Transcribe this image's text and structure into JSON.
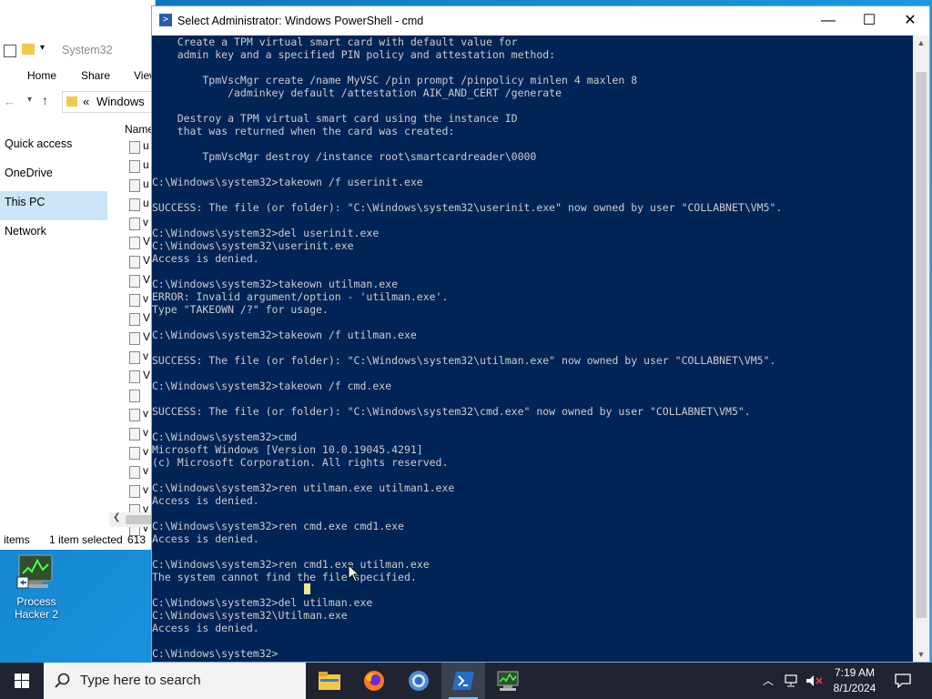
{
  "desktop": {
    "icons": [
      {
        "label": "Process Hacker 2"
      }
    ]
  },
  "explorer": {
    "title": "System32",
    "ribbon_tabs": [
      "Home",
      "Share",
      "View"
    ],
    "address": "Windows",
    "address_prefix": "«",
    "column_header": "Name",
    "nav": [
      "Quick access",
      "OneDrive",
      "This PC",
      "Network"
    ],
    "file_prefixes": [
      "u",
      "u",
      "u",
      "u",
      "v",
      "V",
      "V",
      "V",
      "v",
      "V",
      "V",
      "v",
      "V",
      "",
      "v",
      "v",
      "v",
      "v",
      "v",
      "v",
      "v"
    ],
    "status_items": "items",
    "status_selected": "1 item selected",
    "status_size": "613"
  },
  "powershell": {
    "title": "Select Administrator: Windows PowerShell - cmd",
    "console_lines": [
      "    Create a TPM virtual smart card with default value for",
      "    admin key and a specified PIN policy and attestation method:",
      "",
      "        TpmVscMgr create /name MyVSC /pin prompt /pinpolicy minlen 4 maxlen 8",
      "            /adminkey default /attestation AIK_AND_CERT /generate",
      "",
      "    Destroy a TPM virtual smart card using the instance ID",
      "    that was returned when the card was created:",
      "",
      "        TpmVscMgr destroy /instance root\\smartcardreader\\0000",
      "",
      "C:\\Windows\\system32>takeown /f userinit.exe",
      "",
      "SUCCESS: The file (or folder): \"C:\\Windows\\system32\\userinit.exe\" now owned by user \"COLLABNET\\VM5\".",
      "",
      "C:\\Windows\\system32>del userinit.exe",
      "C:\\Windows\\system32\\userinit.exe",
      "Access is denied.",
      "",
      "C:\\Windows\\system32>takeown utilman.exe",
      "ERROR: Invalid argument/option - 'utilman.exe'.",
      "Type \"TAKEOWN /?\" for usage.",
      "",
      "C:\\Windows\\system32>takeown /f utilman.exe",
      "",
      "SUCCESS: The file (or folder): \"C:\\Windows\\system32\\utilman.exe\" now owned by user \"COLLABNET\\VM5\".",
      "",
      "C:\\Windows\\system32>takeown /f cmd.exe",
      "",
      "SUCCESS: The file (or folder): \"C:\\Windows\\system32\\cmd.exe\" now owned by user \"COLLABNET\\VM5\".",
      "",
      "C:\\Windows\\system32>cmd",
      "Microsoft Windows [Version 10.0.19045.4291]",
      "(c) Microsoft Corporation. All rights reserved.",
      "",
      "C:\\Windows\\system32>ren utilman.exe utilman1.exe",
      "Access is denied.",
      "",
      "C:\\Windows\\system32>ren cmd.exe cmd1.exe",
      "Access is denied.",
      "",
      "C:\\Windows\\system32>ren cmd1.exe utilman.exe",
      "The system cannot find the file specified.",
      "",
      "C:\\Windows\\system32>del utilman.exe",
      "C:\\Windows\\system32\\Utilman.exe",
      "Access is denied.",
      "",
      "C:\\Windows\\system32>"
    ]
  },
  "taskbar": {
    "search_placeholder": "Type here to search",
    "apps": [
      "file-explorer",
      "firefox",
      "chrome",
      "powershell",
      "process-hacker"
    ],
    "time": "7:19 AM",
    "date": "8/1/2024"
  }
}
